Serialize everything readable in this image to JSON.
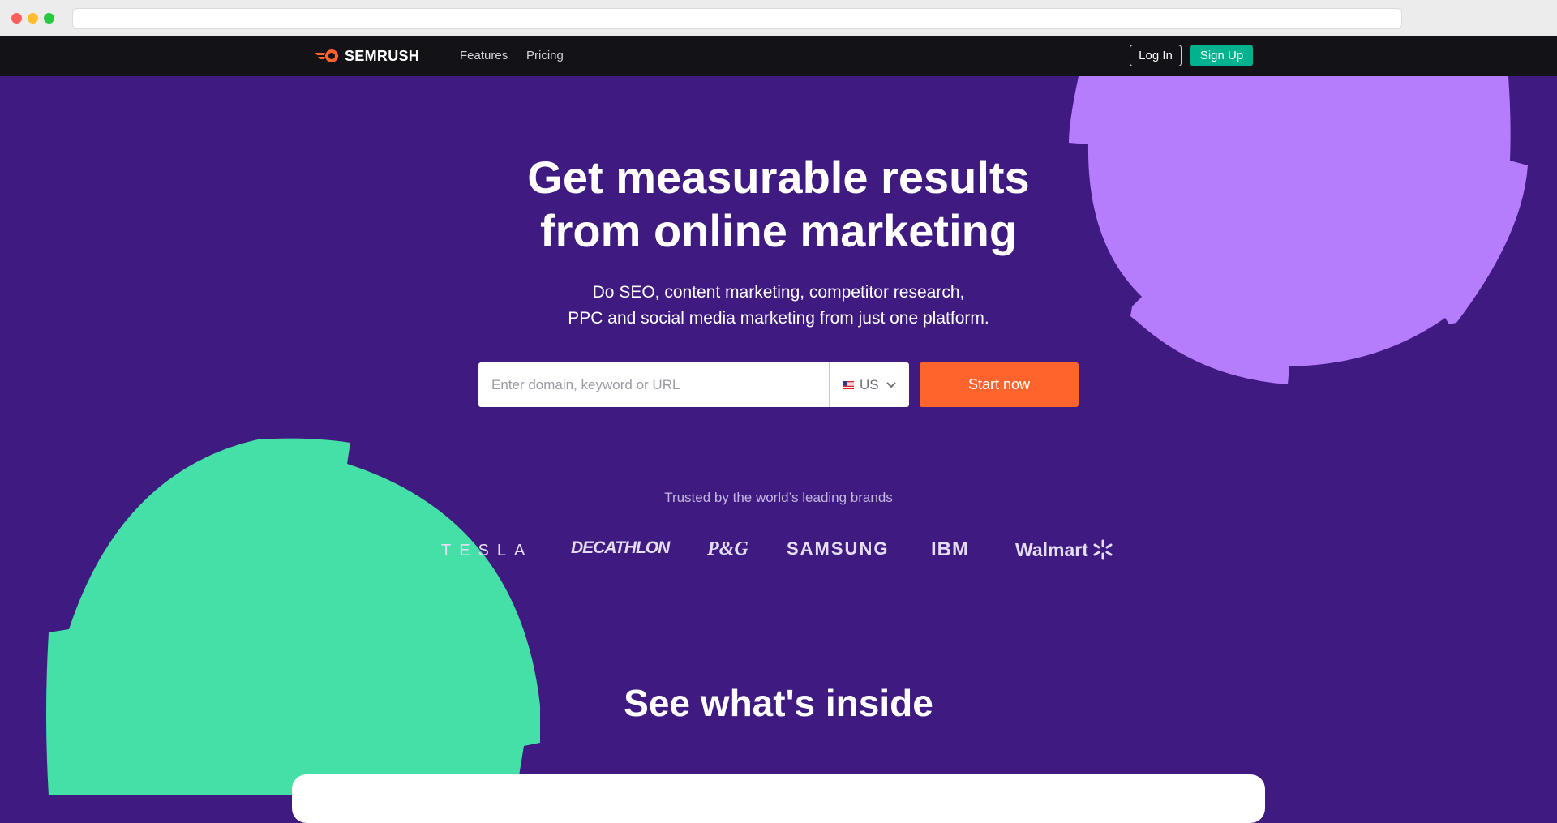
{
  "nav": {
    "logo_text": "SEMRUSH",
    "features_label": "Features",
    "pricing_label": "Pricing",
    "login_label": "Log In",
    "signup_label": "Sign Up"
  },
  "hero": {
    "title_line1": "Get measurable results",
    "title_line2": "from online marketing",
    "subtitle_line1": "Do SEO, content marketing, competitor research,",
    "subtitle_line2": "PPC and social media marketing from just one platform.",
    "search_placeholder": "Enter domain, keyword or URL",
    "region_value": "US",
    "start_label": "Start now"
  },
  "trusted": {
    "label": "Trusted by the world’s leading brands",
    "brands": [
      "TESLA",
      "DECATHLON",
      "P&G",
      "SAMSUNG",
      "IBM",
      "Walmart"
    ]
  },
  "inside": {
    "title": "See what's inside"
  },
  "colors": {
    "background": "#3f1a80",
    "nav": "#121217",
    "accent_orange": "#ff642d",
    "signup_green": "#00b38e",
    "blob_purple": "#b57cfc",
    "blob_green": "#45e0a8"
  },
  "icons": [
    "semrush-fire-icon",
    "us-flag-icon",
    "chevron-down-icon",
    "walmart-spark-icon"
  ]
}
